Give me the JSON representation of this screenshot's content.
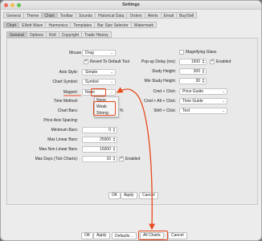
{
  "window": {
    "title": "Settings"
  },
  "top_tabs": [
    "General",
    "Theme",
    "Chart",
    "Toolbar",
    "Sounds",
    "Historical Data",
    "Orders",
    "Alerts",
    "Email",
    "Buy/Sell"
  ],
  "sub_tabs": [
    "Chart",
    "Elliott Wave",
    "Harmonics",
    "Templates",
    "Bar Size Selector",
    "Watermark"
  ],
  "inner_tabs": [
    "General",
    "Options",
    "Roll",
    "Copyright",
    "Trade History"
  ],
  "left": {
    "mouse_tool": {
      "label": "Mouse Tool:",
      "value": "Drag"
    },
    "revert": {
      "label": "Revert To Default Tool",
      "checked": true
    },
    "axis_style": {
      "label": "Axis Style:",
      "value": "Simple"
    },
    "chart_symbol": {
      "label": "Chart Symbol:",
      "value": "Symbol"
    },
    "magnet": {
      "label": "Magnet:",
      "value": "None",
      "options": [
        "None",
        "Weak",
        "Strong"
      ]
    },
    "time_method": {
      "label": "Time Method:"
    },
    "chart_bars": {
      "label": "Chart Bars:",
      "unit": "%"
    },
    "price_axis_spacing": {
      "label": "Price Axis Spacing:"
    },
    "minimum_bars": {
      "label": "Minimum Bars:",
      "value": "0"
    },
    "max_linear_bars": {
      "label": "Max Linear Bars:",
      "value": "25000"
    },
    "max_non_linear_bars": {
      "label": "Max Non Linear Bars:",
      "value": "15000"
    },
    "max_days": {
      "label": "Max Days (Tick Charts):",
      "value": "10",
      "enabled_label": "Enabled",
      "enabled": true
    }
  },
  "right": {
    "magnifying_glass": {
      "label": "Magnifying Glass",
      "checked": false
    },
    "popup_delay": {
      "label": "Pop-up Delay (ms):",
      "value": "1500",
      "enabled_label": "Enabled",
      "enabled": true
    },
    "study_height": {
      "label": "Study Height:",
      "value": "300"
    },
    "min_study_height": {
      "label": "Min Study Height:",
      "value": "30"
    },
    "cmd_click": {
      "label": "Cmd + Click:",
      "value": "Price Guide"
    },
    "cmd_alt_click": {
      "label": "Cmd + Alt + Click:",
      "value": "Time Guide"
    },
    "shift_click": {
      "label": "Shift + Click:",
      "value": "Text"
    }
  },
  "panel_buttons": {
    "ok": "OK",
    "apply": "Apply",
    "cancel": "Cancel"
  },
  "footer": {
    "ok": "OK",
    "apply": "Apply",
    "defaults": "Defaults",
    "all_charts": "All Charts",
    "cancel": "Cancel"
  },
  "colors": {
    "highlight": "#e8491d"
  }
}
